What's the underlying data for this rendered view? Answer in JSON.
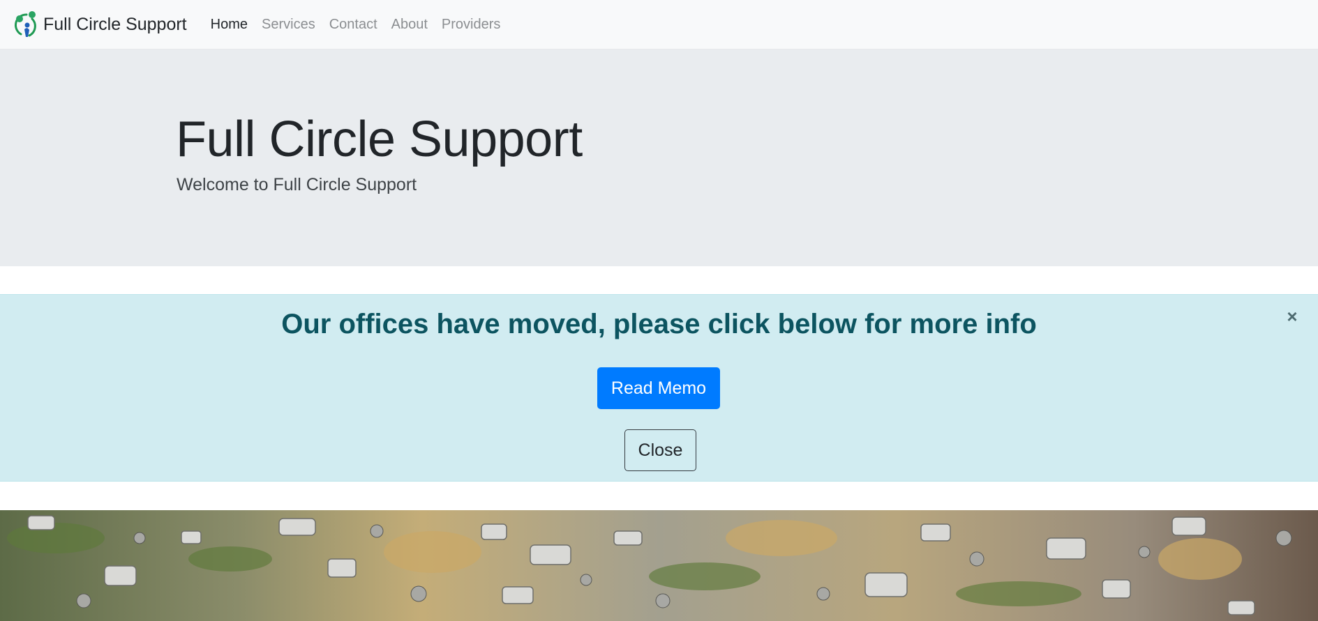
{
  "navbar": {
    "brand_text": "Full Circle Support",
    "logo_icon": "people-circle-logo-icon",
    "links": [
      {
        "label": "Home",
        "active": true
      },
      {
        "label": "Services",
        "active": false
      },
      {
        "label": "Contact",
        "active": false
      },
      {
        "label": "About",
        "active": false
      },
      {
        "label": "Providers",
        "active": false
      }
    ]
  },
  "jumbotron": {
    "title": "Full Circle Support",
    "lead": "Welcome to Full Circle Support"
  },
  "alert": {
    "heading": "Our offices have moved, please click below for more info",
    "close_symbol": "×",
    "primary_button": "Read Memo",
    "secondary_button": "Close"
  },
  "colors": {
    "primary": "#007bff",
    "alert_bg": "#d1ecf1",
    "alert_text": "#0c5460",
    "jumbotron_bg": "#e9ecef",
    "navbar_bg": "#f8f9fa"
  }
}
